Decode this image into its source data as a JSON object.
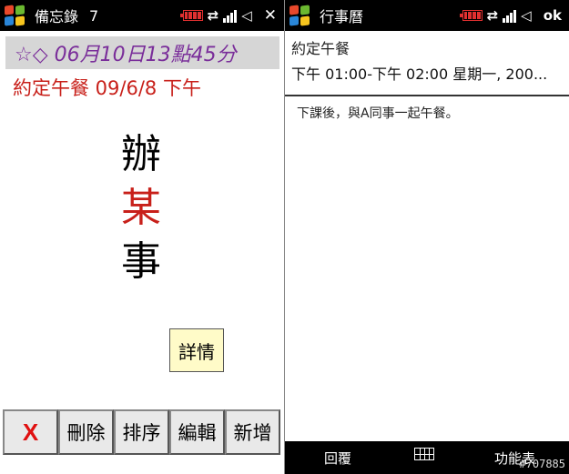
{
  "left": {
    "statusbar": {
      "app_title": "備忘錄",
      "count": "7",
      "action": "✕"
    },
    "date_header": "☆◇ 06月10日13點45分",
    "event_line": "約定午餐  09/6/8  下午",
    "stacked_text": [
      "辦",
      "某",
      "事"
    ],
    "detail_button": "詳情",
    "toolbar": {
      "delete_x": "X",
      "delete": "刪除",
      "sort": "排序",
      "edit": "編輯",
      "new": "新增"
    }
  },
  "right": {
    "statusbar": {
      "app_title": "行事曆",
      "action": "ok"
    },
    "event_title": "約定午餐",
    "event_time": "下午 01:00-下午 02:00 星期一, 200...",
    "event_note": "下課後，與A同事一起午餐。",
    "softkeys": {
      "left": "回覆",
      "right": "功能表"
    }
  },
  "watermark": "#707885",
  "colors": {
    "accent_purple": "#7a2e9a",
    "accent_red": "#c8201a",
    "delete_red": "#e01010",
    "detail_yellow": "#fffbc8"
  },
  "icons": [
    "windows-logo-icon",
    "battery-icon",
    "sync-arrows-icon",
    "signal-icon",
    "speaker-muted-icon",
    "keyboard-icon"
  ]
}
